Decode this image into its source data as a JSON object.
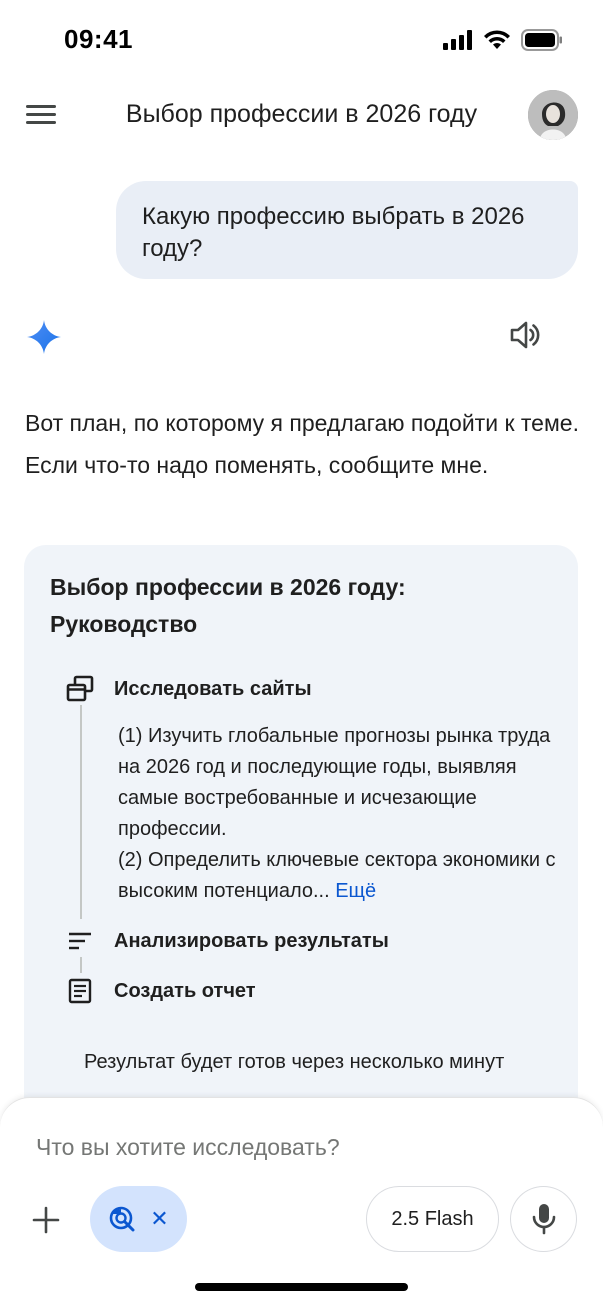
{
  "status_bar": {
    "time": "09:41",
    "icons": [
      "cellular-signal-icon",
      "wifi-icon",
      "battery-icon"
    ]
  },
  "header": {
    "menu_icon": "hamburger-menu-icon",
    "title": "Выбор профессии в 2026 году",
    "avatar": "user-avatar"
  },
  "conversation": {
    "user_message": "Какую профессию выбрать в 2026 году?",
    "assistant_icon": "gemini-sparkle-icon",
    "speaker_icon": "speaker-icon",
    "response_text": "Вот план, по которому я предлагаю подойти к теме. Если что-то надо поменять, сообщите мне."
  },
  "plan": {
    "title": "Выбор профессии в 2026 году: Руководство",
    "steps": [
      {
        "icon": "browse-sites-icon",
        "label": "Исследовать сайты",
        "description": "(1) Изучить глобальные прогнозы рынка труда на 2026 год и последующие годы, выявляя самые востребованные и исчезающие профессии.\n(2) Определить ключевые сектора экономики с высоким потенциало...",
        "more_label": "Ещё"
      },
      {
        "icon": "analyze-results-icon",
        "label": "Анализировать результаты"
      },
      {
        "icon": "create-report-icon",
        "label": "Создать отчет"
      }
    ],
    "status_text": "Результат будет готов через несколько минут"
  },
  "input_bar": {
    "placeholder": "Что вы хотите исследовать?",
    "plus_icon": "plus-icon",
    "tool_icon": "deep-research-icon",
    "tool_close_icon": "close-icon",
    "model_label": "2.5 Flash",
    "mic_icon": "microphone-icon"
  },
  "colors": {
    "accent": "#0b57d0",
    "bubble": "#e9eef6",
    "card": "#f0f4f9",
    "chip": "#d3e3fd"
  }
}
